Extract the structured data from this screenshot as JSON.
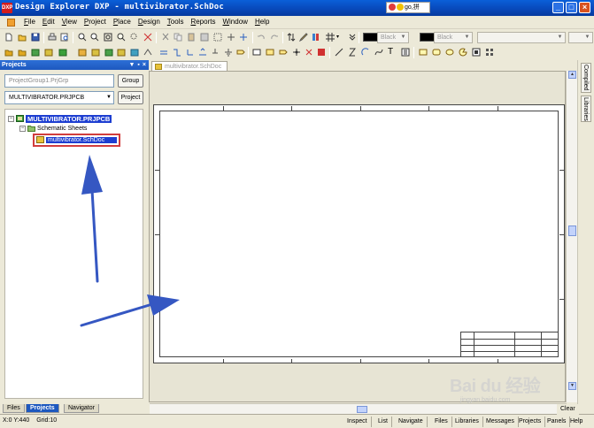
{
  "window": {
    "title": "Design Explorer DXP - multivibrator.SchDoc",
    "app_logo_text": "DXP",
    "ime_text": "go,拼",
    "title_color": "#0847b8"
  },
  "menu": {
    "items": [
      "File",
      "Edit",
      "View",
      "Project",
      "Place",
      "Design",
      "Tools",
      "Reports",
      "Window",
      "Help"
    ]
  },
  "toolbar": {
    "fill_color_label": "Black",
    "line_color_label": "Black"
  },
  "projects_panel": {
    "title": "Projects",
    "workspace_field": "ProjectGroup1.PrjGrp",
    "group_button": "Group",
    "project_select": "MULTIVIBRATOR.PRJPCB",
    "project_button": "Project",
    "tree": {
      "project": "MULTIVIBRATOR.PRJPCB",
      "folder": "Schematic Sheets",
      "document": "multivibrator.SchDoc"
    },
    "tabs": [
      "Files",
      "Projects",
      "Navigator"
    ],
    "active_tab": "Projects"
  },
  "document": {
    "tab_label": "multivibrator.SchDoc"
  },
  "right_panel_tabs": [
    "Compiled",
    "Libraries"
  ],
  "status_bar": {
    "coords": "X:0 Y:440",
    "grid": "Grid:10",
    "buttons": [
      "Inspect",
      "List",
      "Navigate",
      "Files",
      "Libraries",
      "Messages",
      "Projects",
      "Panels",
      "Help",
      "Clear"
    ]
  },
  "watermark": {
    "main": "Bai du 经验",
    "sub": "jingyan.baidu.com"
  },
  "colors": {
    "selection": "#1d3ed1",
    "highlight_box": "#d23d3d",
    "arrow": "#3557c2"
  }
}
